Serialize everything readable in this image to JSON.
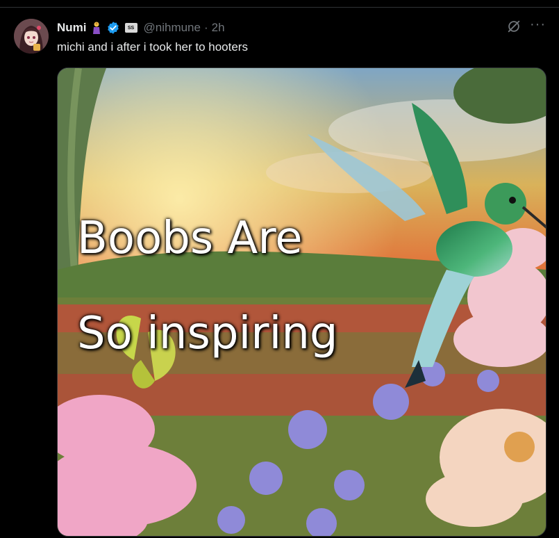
{
  "post": {
    "author_name": "Numi",
    "handle": "@nihmune",
    "separator": "·",
    "time": "2h",
    "affiliation_badge": "SS",
    "text": "michi and i after i took her to hooters",
    "more_label": "···"
  },
  "media": {
    "overlay_line1": "Boobs Are",
    "overlay_line2": "So inspiring"
  },
  "colors": {
    "background": "#000000",
    "text": "#e7e9ea",
    "muted": "#71767b",
    "verified": "#1d9bf0",
    "border": "#2f3336"
  },
  "icons": {
    "avatar": "anime-avatar",
    "emoji": "woman-emoji",
    "verified": "verified-badge-icon",
    "grok": "grok-icon",
    "more": "more-icon"
  }
}
